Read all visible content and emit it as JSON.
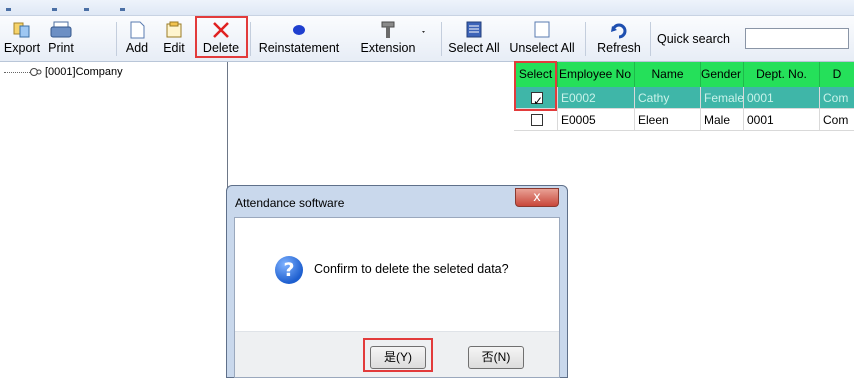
{
  "toolbar": {
    "export_label": "Export",
    "print_label": "Print",
    "add_label": "Add",
    "edit_label": "Edit",
    "delete_label": "Delete",
    "reinstatement_label": "Reinstatement",
    "extension_label": "Extension",
    "select_all_label": "Select All",
    "unselect_all_label": "Unselect All",
    "refresh_label": "Refresh",
    "quick_search_label": "Quick search",
    "quick_search_value": ""
  },
  "tree": {
    "root_label": "[0001]Company"
  },
  "grid": {
    "columns": [
      "Select",
      "Employee No",
      "Name",
      "Gender",
      "Dept. No.",
      "D"
    ],
    "rows": [
      {
        "checked": true,
        "employee_no": "E0002",
        "name": "Cathy",
        "gender": "Female",
        "dept_no": "0001",
        "dept": "Com"
      },
      {
        "checked": false,
        "employee_no": "E0005",
        "name": "Eleen",
        "gender": "Male",
        "dept_no": "0001",
        "dept": "Com"
      }
    ]
  },
  "dialog": {
    "title": "Attendance software",
    "close_glyph": "x",
    "message": "Confirm to delete the seleted data?",
    "yes_label": "是(Y)",
    "no_label": "否(N)"
  },
  "colors": {
    "highlight_red": "#e23b3b",
    "grid_header": "#25e05a",
    "selected_row": "#3fb6a8"
  }
}
